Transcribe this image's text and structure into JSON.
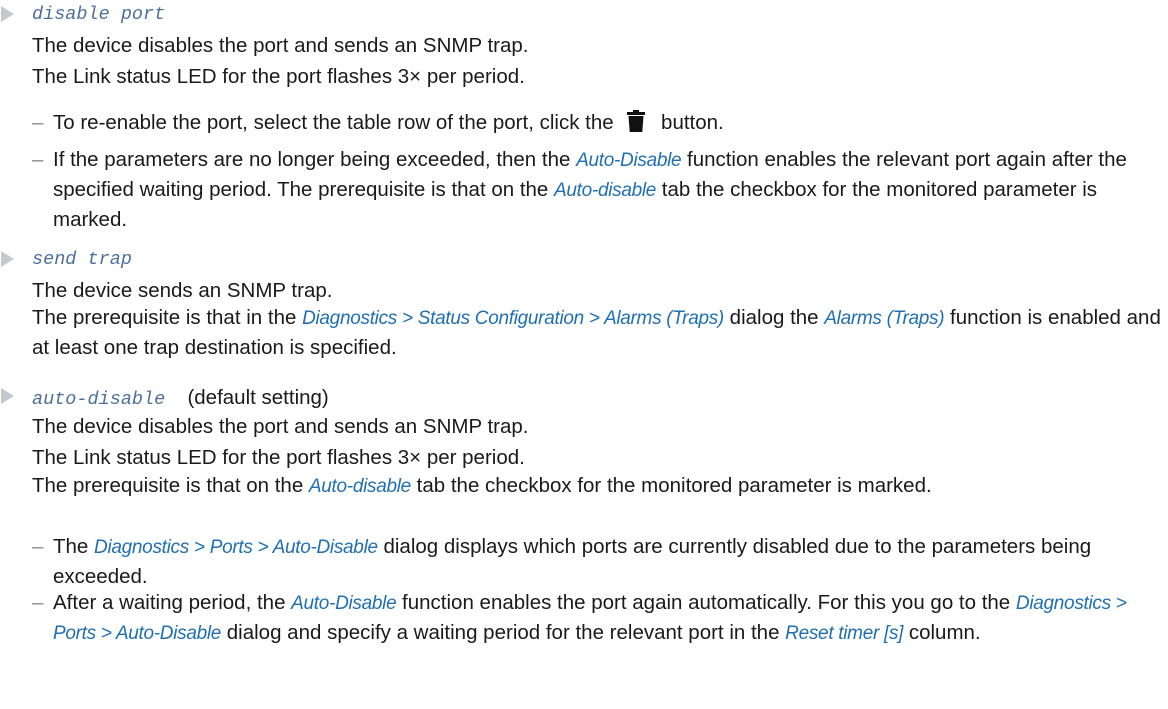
{
  "disable_port": {
    "option": "disable port",
    "line1": "The device disables the port and sends an SNMP trap.",
    "line2": "The Link status LED for the port flashes 3× per period.",
    "bullet1": {
      "before": "To re-enable the port, select the table row of the port, click the",
      "icon": "trash-icon",
      "after": "button."
    },
    "bullet2": {
      "t1": "If the parameters are no longer being exceeded, then the ",
      "ui1": "Auto-Disable",
      "t2": " function enables the relevant port again after the specified waiting period. The prerequisite is that on the ",
      "ui2": "Auto-disable",
      "t3": " tab the checkbox for the monitored parameter is marked."
    }
  },
  "send_trap": {
    "option": "send trap",
    "line1": "The device sends an SNMP trap.",
    "para": {
      "t1": "The prerequisite is that in the ",
      "ui1": "Diagnostics > Status Configuration > Alarms (Traps)",
      "t2": " dialog the ",
      "ui2": "Alarms (Traps)",
      "t3": " function is enabled and at least one trap destination is specified."
    }
  },
  "auto_disable": {
    "option": "auto-disable",
    "suffix": "(default setting)",
    "line1": "The device disables the port and sends an SNMP trap.",
    "line2": "The Link status LED for the port flashes 3× per period.",
    "para": {
      "t1": "The prerequisite is that on the ",
      "ui1": "Auto-disable",
      "t2": " tab the checkbox for the monitored parameter is marked."
    },
    "bullet1": {
      "t1": "The ",
      "ui1": "Diagnostics > Ports > Auto-Disable",
      "t2": " dialog displays which ports are currently disabled due to the parameters being exceeded."
    },
    "bullet2": {
      "t1": "After a waiting period, the ",
      "ui1": "Auto-Disable",
      "t2": " function enables the port again automatically. For this you go to the ",
      "ui2": "Diagnostics > Ports > Auto-Disable",
      "t3": " dialog and specify a waiting period for the relevant port in the ",
      "ui3": "Reset timer [s]",
      "t4": " column."
    }
  },
  "dash": "–",
  "colors": {
    "link": "#1f6fb2",
    "code": "#4d6f9c",
    "marker": "#c5c8cc"
  }
}
